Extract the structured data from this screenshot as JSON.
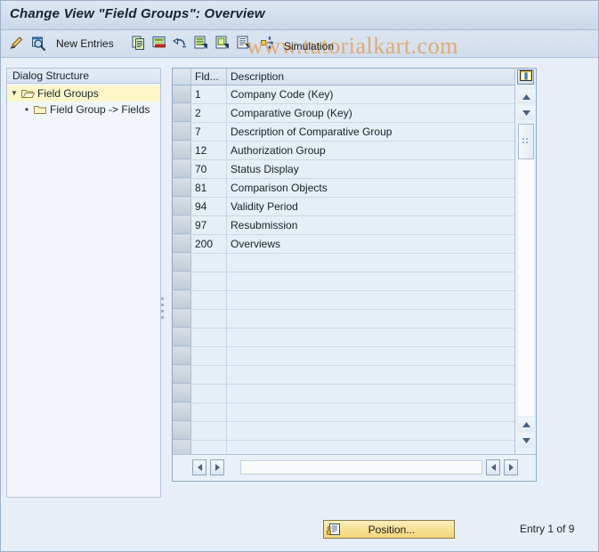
{
  "window": {
    "title": "Change View \"Field Groups\": Overview"
  },
  "watermark": {
    "text": "www.tutorialkart.com",
    "color": "#e0a35c"
  },
  "toolbar": {
    "items": [
      {
        "name": "change-display-icon",
        "label": "",
        "icon": "pencil-icon"
      },
      {
        "name": "display-search-icon",
        "label": "",
        "icon": "magnifier-icon"
      },
      {
        "name": "new-entries-button",
        "label": "New Entries",
        "icon": ""
      },
      {
        "name": "copy-as-icon",
        "label": "",
        "icon": "copy-icon"
      },
      {
        "name": "delete-icon",
        "label": "",
        "icon": "delete-icon"
      },
      {
        "name": "undo-icon",
        "label": "",
        "icon": "undo-icon"
      },
      {
        "name": "select-all-icon",
        "label": "",
        "icon": "select-all-icon"
      },
      {
        "name": "deselect-all-icon",
        "label": "",
        "icon": "deselect-all-icon"
      },
      {
        "name": "select-block-icon",
        "label": "",
        "icon": "select-block-icon"
      },
      {
        "name": "transport-icon",
        "label": "",
        "icon": "transport-icon"
      }
    ],
    "simulation_label": "Simulation"
  },
  "dialog_structure": {
    "header": "Dialog Structure",
    "nodes": [
      {
        "label": "Field Groups",
        "selected": true,
        "expanded": true,
        "level": 0,
        "icon": "open-folder-icon"
      },
      {
        "label": "Field Group -> Fields",
        "selected": false,
        "expanded": false,
        "level": 1,
        "icon": "folder-icon"
      }
    ]
  },
  "table": {
    "columns": [
      {
        "key": "fld",
        "label": "Fld..."
      },
      {
        "key": "description",
        "label": "Description"
      }
    ],
    "rows": [
      {
        "fld": "1",
        "description": "Company Code (Key)"
      },
      {
        "fld": "2",
        "description": "Comparative Group (Key)"
      },
      {
        "fld": "7",
        "description": "Description of Comparative Group"
      },
      {
        "fld": "12",
        "description": "Authorization Group"
      },
      {
        "fld": "70",
        "description": "Status Display"
      },
      {
        "fld": "81",
        "description": "Comparison Objects"
      },
      {
        "fld": "94",
        "description": "Validity Period"
      },
      {
        "fld": "97",
        "description": "Resubmission"
      },
      {
        "fld": "200",
        "description": "Overviews"
      }
    ],
    "empty_row_count": 11,
    "config_icon": "table-settings-icon"
  },
  "footer": {
    "position_button_label": "Position...",
    "position_button_icon": "position-icon",
    "entry_status": "Entry 1 of 9"
  }
}
